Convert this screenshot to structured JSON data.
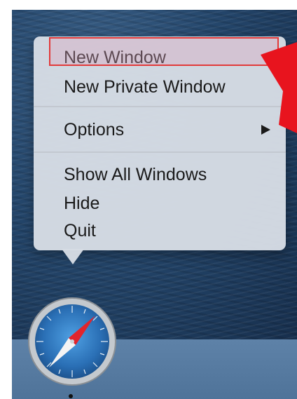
{
  "menu": {
    "items": [
      {
        "label": "New Window"
      },
      {
        "label": "New Private Window"
      },
      {
        "label": "Options"
      },
      {
        "label": "Show All Windows"
      },
      {
        "label": "Hide"
      },
      {
        "label": "Quit"
      }
    ],
    "highlighted_item": "New Window"
  },
  "icons": {
    "app": "safari-compass-icon",
    "submenu": "submenu-arrow-icon",
    "pointer": "red-pointer-arrow"
  },
  "colors": {
    "highlight_border": "#e23a3a",
    "pointer_arrow": "#e8141e",
    "menu_background": "#d6dce4",
    "dock": "#5e82a8"
  }
}
